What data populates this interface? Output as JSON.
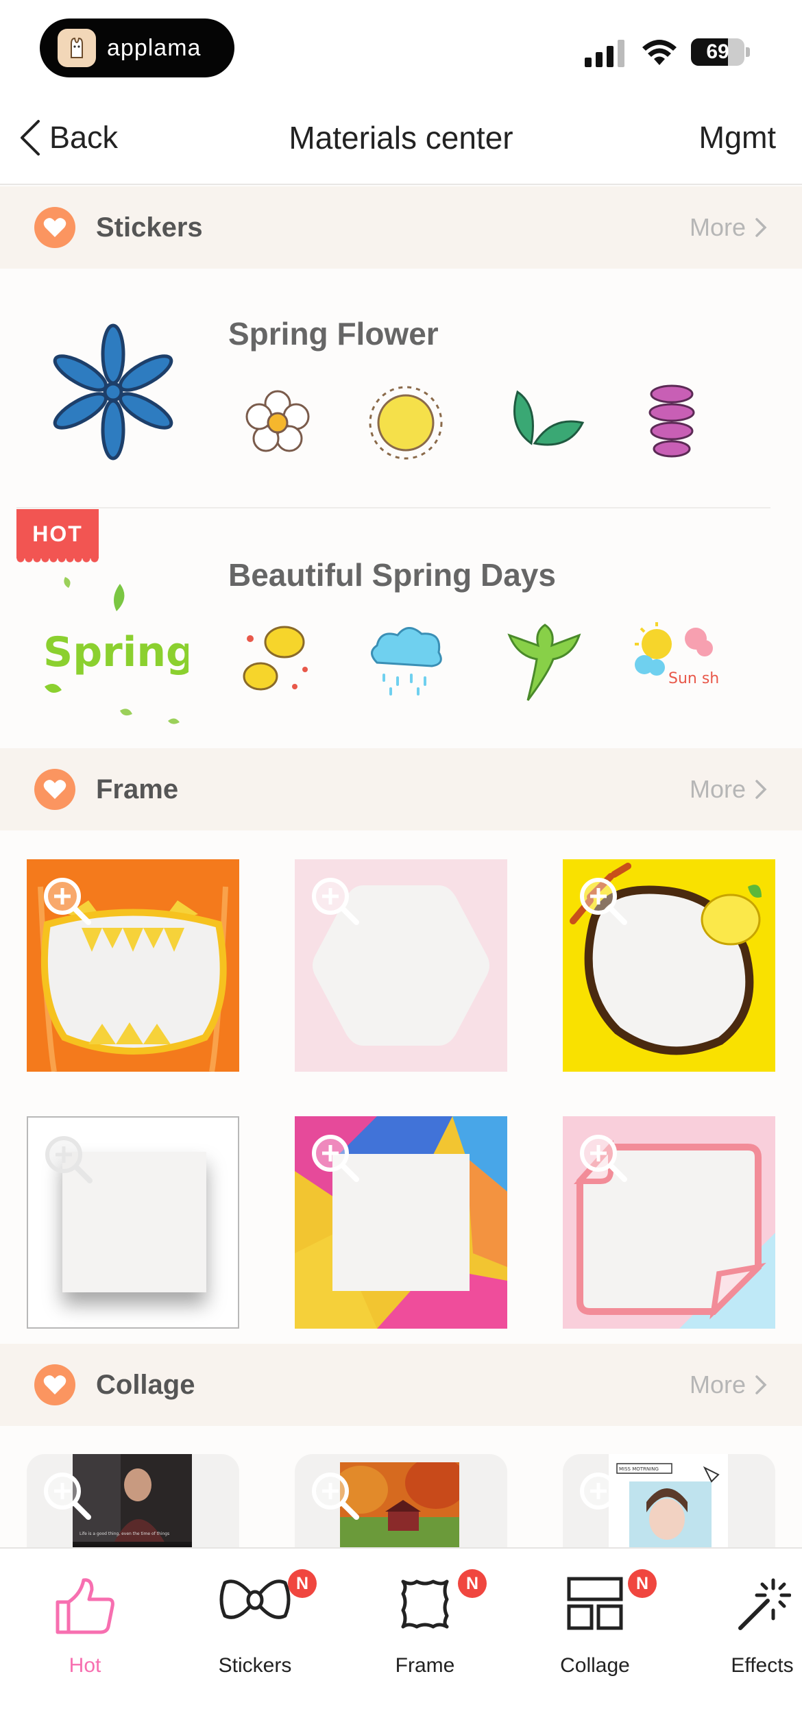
{
  "status_bar": {
    "app_pill": "applama",
    "battery": "69",
    "battery_level": 0.69
  },
  "nav": {
    "back_label": "Back",
    "title": "Materials center",
    "right_label": "Mgmt"
  },
  "sections": {
    "stickers": {
      "title": "Stickers",
      "more": "More"
    },
    "frame": {
      "title": "Frame",
      "more": "More"
    },
    "collage": {
      "title": "Collage",
      "more": "More"
    }
  },
  "sticker_packs": [
    {
      "title": "Spring Flower",
      "badge": ""
    },
    {
      "title": "Beautiful Spring Days",
      "badge": "HOT",
      "cover_text": "Spring",
      "thumb_text": "Sun shine"
    }
  ],
  "collage_previews": {
    "first_caption": "Life is a good thing, even the time of things",
    "third_caption": "MISS MOTRNING"
  },
  "tabs": [
    {
      "label": "Hot",
      "active": true,
      "badge": ""
    },
    {
      "label": "Stickers",
      "active": false,
      "badge": "N"
    },
    {
      "label": "Frame",
      "active": false,
      "badge": "N"
    },
    {
      "label": "Collage",
      "active": false,
      "badge": "N"
    },
    {
      "label": "Effects",
      "active": false,
      "badge": ""
    }
  ],
  "colors": {
    "accent": "#fb9560",
    "active_tab": "#f76fb0",
    "badge": "#f0463f",
    "hot": "#f25552"
  },
  "icons": [
    "back-chevron-icon",
    "heart-icon",
    "chevron-right-icon",
    "zoom-in-icon",
    "thumbs-up-icon",
    "bow-icon",
    "frame-icon",
    "collage-icon",
    "magic-wand-icon"
  ]
}
